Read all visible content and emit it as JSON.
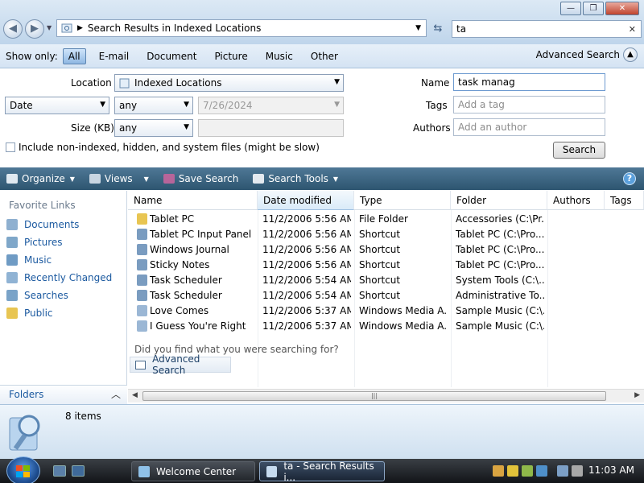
{
  "address": {
    "path": "Search Results in Indexed Locations",
    "search_value": "ta"
  },
  "show_only": {
    "label": "Show only:",
    "filters": [
      "All",
      "E-mail",
      "Document",
      "Picture",
      "Music",
      "Other"
    ],
    "active": "All",
    "advanced_label": "Advanced Search"
  },
  "advanced": {
    "location_label": "Location",
    "location_value": "Indexed Locations",
    "date_field": "Date",
    "date_op": "any",
    "date_value": "7/26/2024",
    "size_label": "Size (KB)",
    "size_op": "any",
    "name_label": "Name",
    "name_value": "task manag",
    "tags_label": "Tags",
    "tags_placeholder": "Add a tag",
    "authors_label": "Authors",
    "authors_placeholder": "Add an author",
    "include_label": "Include non-indexed, hidden, and system files (might be slow)",
    "search_button": "Search"
  },
  "toolbar": {
    "organize": "Organize",
    "views": "Views",
    "save_search": "Save Search",
    "search_tools": "Search Tools",
    "help": "?"
  },
  "nav": {
    "title": "Favorite Links",
    "items": [
      "Documents",
      "Pictures",
      "Music",
      "Recently Changed",
      "Searches",
      "Public"
    ],
    "folders": "Folders"
  },
  "columns": [
    "Name",
    "Date modified",
    "Type",
    "Folder",
    "Authors",
    "Tags"
  ],
  "rows": [
    {
      "name": "Tablet PC",
      "date": "11/2/2006 5:56 AM",
      "type": "File Folder",
      "folder": "Accessories (C:\\Pr..."
    },
    {
      "name": "Tablet PC Input Panel",
      "date": "11/2/2006 5:56 AM",
      "type": "Shortcut",
      "folder": "Tablet PC (C:\\Pro..."
    },
    {
      "name": "Windows Journal",
      "date": "11/2/2006 5:56 AM",
      "type": "Shortcut",
      "folder": "Tablet PC (C:\\Pro..."
    },
    {
      "name": "Sticky Notes",
      "date": "11/2/2006 5:56 AM",
      "type": "Shortcut",
      "folder": "Tablet PC (C:\\Pro..."
    },
    {
      "name": "Task Scheduler",
      "date": "11/2/2006 5:54 AM",
      "type": "Shortcut",
      "folder": "System Tools (C:\\..."
    },
    {
      "name": "Task Scheduler",
      "date": "11/2/2006 5:54 AM",
      "type": "Shortcut",
      "folder": "Administrative To..."
    },
    {
      "name": "Love Comes",
      "date": "11/2/2006 5:37 AM",
      "type": "Windows Media A...",
      "folder": "Sample Music (C:\\..."
    },
    {
      "name": "I Guess You're Right",
      "date": "11/2/2006 5:37 AM",
      "type": "Windows Media A...",
      "folder": "Sample Music (C:\\..."
    }
  ],
  "row_icons": [
    "folder-icon",
    "shortcut-icon",
    "shortcut-icon",
    "shortcut-icon",
    "shortcut-icon",
    "shortcut-icon",
    "music-icon",
    "music-icon"
  ],
  "found_prompt": "Did you find what you were searching for?",
  "advanced_link": "Advanced Search",
  "status": {
    "count": "8 items"
  },
  "taskbar": {
    "tasks": [
      "Welcome Center",
      "ta - Search Results i..."
    ],
    "clock": "11:03 AM"
  },
  "colors": {
    "accent": "#1c5aa0",
    "toolbar": "#3b637f",
    "folder": "#e8c552"
  }
}
